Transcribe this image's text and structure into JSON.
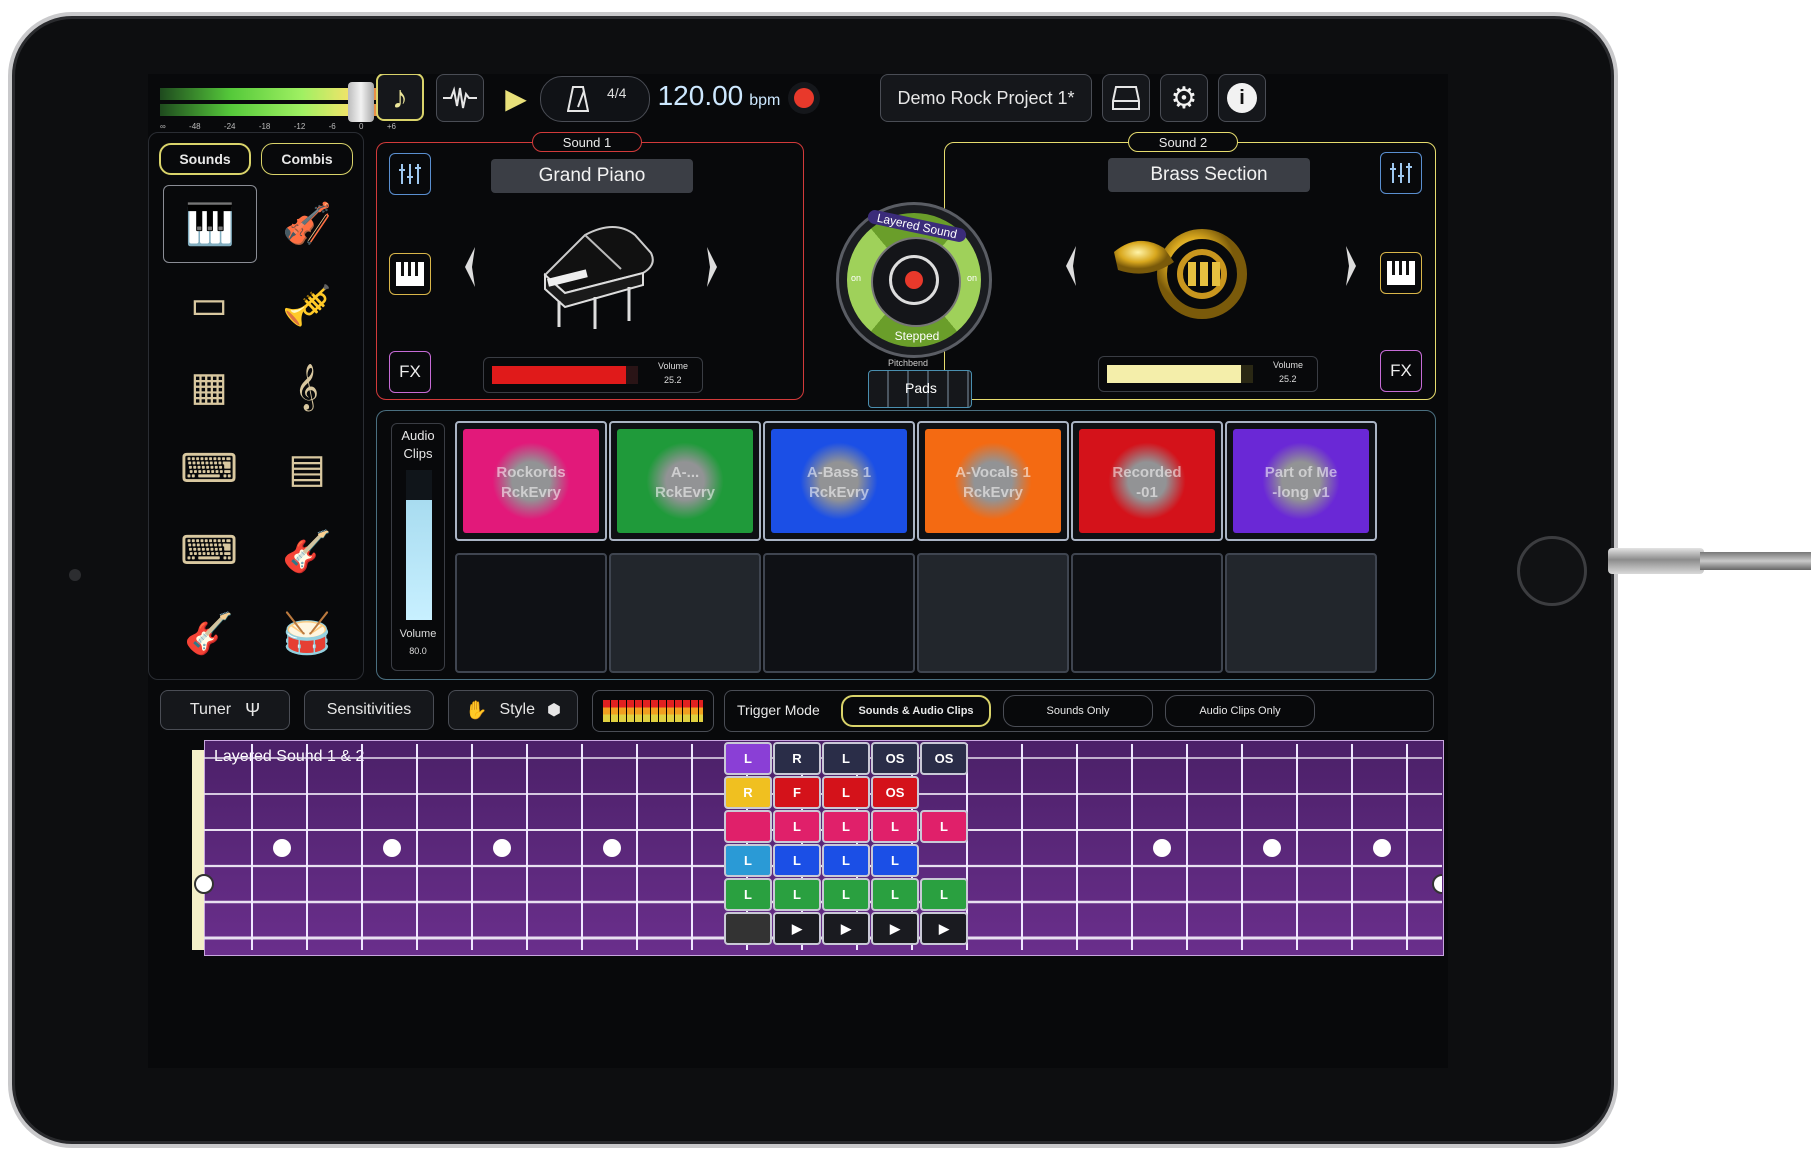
{
  "meter": {
    "scale": [
      "∞",
      "-48",
      "-24",
      "-18",
      "-12",
      "-6",
      "0",
      "+6"
    ]
  },
  "transport": {
    "time_sig": "4/4",
    "tempo": "120.00",
    "tempo_unit": "bpm"
  },
  "project": {
    "name": "Demo Rock Project 1*"
  },
  "library": {
    "tabs": [
      {
        "label": "Sounds",
        "active": true
      },
      {
        "label": "Combis",
        "active": false
      }
    ],
    "instruments": [
      "grand-piano",
      "violin",
      "electric-piano",
      "brass",
      "organ",
      "woodwinds",
      "synthesizer",
      "vibraphone",
      "keyboard",
      "electric-guitar",
      "bass-guitar",
      "drum-kit"
    ]
  },
  "sound1": {
    "tag": "Sound 1",
    "name": "Grand Piano",
    "volume_label": "Volume",
    "volume": "25.2",
    "volume_fill": 0.92,
    "fx": "FX"
  },
  "sound2": {
    "tag": "Sound 2",
    "name": "Brass Section",
    "volume_label": "Volume",
    "volume": "25.2",
    "volume_fill": 0.92,
    "fx": "FX"
  },
  "layer": {
    "top": "Layered Sound",
    "bottom": "Stepped",
    "sub": "Pitchbend",
    "on_left": "on",
    "on_right": "on",
    "pads_label": "Pads"
  },
  "clips": {
    "label_line1": "Audio",
    "label_line2": "Clips",
    "volume_label": "Volume",
    "volume": "80.0",
    "volume_fill": 0.8,
    "pads": [
      {
        "text": "Rockords\nRckEvry",
        "color": "#e2197a"
      },
      {
        "text": "A-...\nRckEvry",
        "color": "#1f9a3a"
      },
      {
        "text": "A-Bass 1\nRckEvry",
        "color": "#1b4fe6"
      },
      {
        "text": "A-Vocals 1\nRckEvry",
        "color": "#f46a12"
      },
      {
        "text": "Recorded\n-01",
        "color": "#d4121a"
      },
      {
        "text": "Part of Me\n-long v1",
        "color": "#6a28d6"
      }
    ]
  },
  "toolbar": {
    "tuner": "Tuner",
    "sensitivities": "Sensitivities",
    "style": "Style",
    "trigger_mode": "Trigger Mode",
    "modes": [
      {
        "label": "Sounds & Audio Clips",
        "active": true
      },
      {
        "label": "Sounds Only",
        "active": false
      },
      {
        "label": "Audio Clips Only",
        "active": false
      }
    ]
  },
  "fretboard": {
    "label": "Layered Sound 1 & 2"
  },
  "trigger_grid": [
    [
      "L",
      "R",
      "L",
      "OS",
      "OS"
    ],
    [
      "R",
      "F",
      "L",
      "OS",
      ""
    ],
    [
      "",
      "L",
      "L",
      "L",
      "L"
    ],
    [
      "L",
      "L",
      "L",
      "L",
      ""
    ],
    [
      "L",
      "L",
      "L",
      "L",
      "L"
    ],
    [
      "",
      "▶",
      "▶",
      "▶",
      "▶"
    ]
  ],
  "colors": {
    "accent_yellow": "#e8e28a",
    "record": "#e8392b",
    "sound1_border": "#d23a3a",
    "sound2_border": "#e6dc6e",
    "fretboard": "#5b2a7a"
  }
}
